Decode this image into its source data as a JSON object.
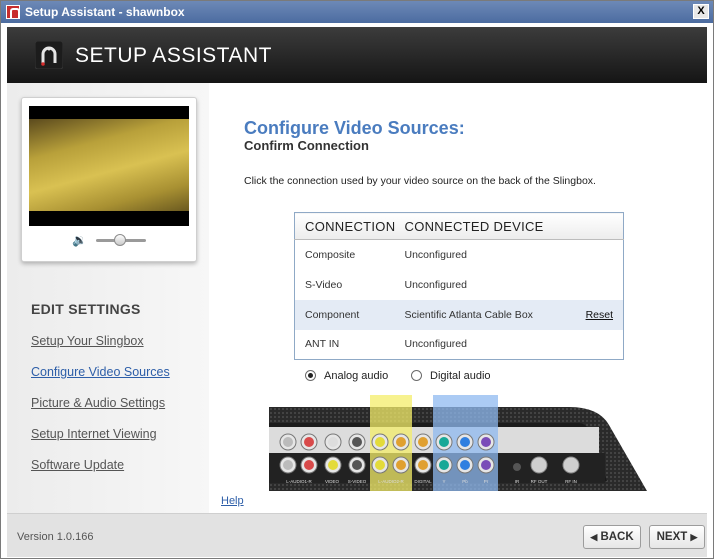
{
  "window": {
    "title": "Setup Assistant - shawnbox",
    "close_label": "X",
    "header_title": "SETUP ASSISTANT"
  },
  "sidebar": {
    "edit_title": "EDIT SETTINGS",
    "items": [
      {
        "label": "Setup Your Slingbox",
        "active": false
      },
      {
        "label": "Configure Video Sources",
        "active": true
      },
      {
        "label": "Picture & Audio Settings",
        "active": false
      },
      {
        "label": "Setup Internet Viewing",
        "active": false
      },
      {
        "label": "Software Update",
        "active": false
      }
    ],
    "volume_icon": "speaker-icon",
    "volume_level": 0.6
  },
  "main": {
    "title": "Configure Video Sources:",
    "subtitle": "Confirm Connection",
    "instruction": "Click the connection used by your video source on the back of the Slingbox.",
    "table": {
      "headers": [
        "CONNECTION",
        "CONNECTED DEVICE"
      ],
      "rows": [
        {
          "connection": "Composite",
          "device": "Unconfigured",
          "action": ""
        },
        {
          "connection": "S-Video",
          "device": "Unconfigured",
          "action": ""
        },
        {
          "connection": "Component",
          "device": "Scientific Atlanta Cable Box",
          "action": "Reset"
        },
        {
          "connection": "ANT IN",
          "device": "Unconfigured",
          "action": ""
        }
      ],
      "selected_row": 2
    },
    "audio": {
      "options": [
        "Analog audio",
        "Digital audio"
      ],
      "selected": "Analog audio"
    },
    "port_labels": [
      "L-AUDIO1-R",
      "VIDEO",
      "S-VIDEO",
      "L-AUDIO2-R",
      "DIGITAL",
      "Y",
      "Pb",
      "Pr",
      "IR",
      "RF OUT",
      "RF IN"
    ],
    "help_label": "Help"
  },
  "footer": {
    "version": "Version 1.0.166",
    "back_label": "BACK",
    "next_label": "NEXT"
  },
  "colors": {
    "accent": "#4a7cbf",
    "selected_row": "#e4ebf5",
    "highlight_yellow": "#f4ee6a",
    "highlight_blue": "#8fbaf0"
  }
}
